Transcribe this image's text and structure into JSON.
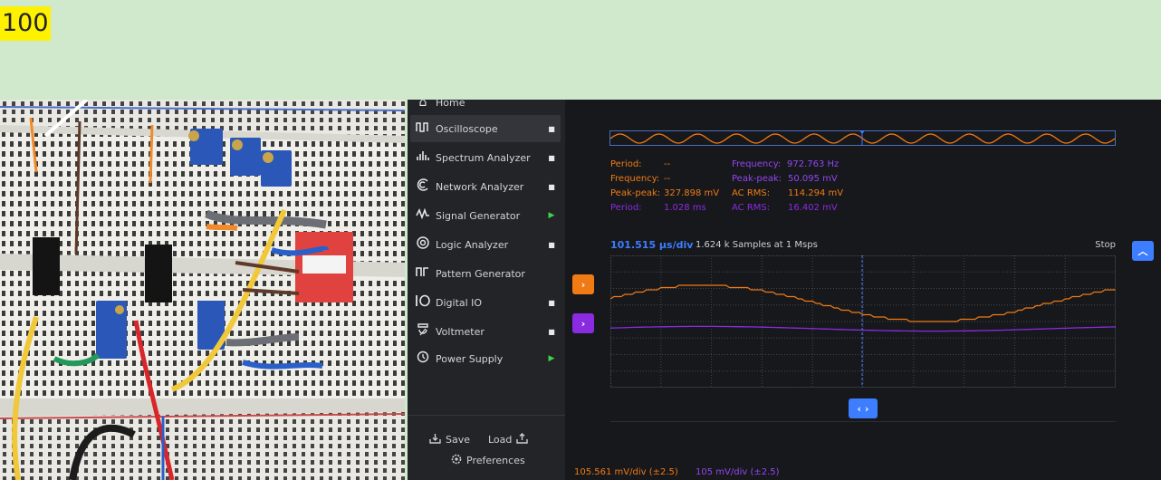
{
  "badge": {
    "text": "100"
  },
  "sidebar": {
    "home_label": "Home",
    "items": [
      {
        "label": "Oscilloscope",
        "icon": "oscilloscope-icon",
        "status": "stop",
        "active": true
      },
      {
        "label": "Spectrum Analyzer",
        "icon": "spectrum-icon",
        "status": "stop",
        "active": false
      },
      {
        "label": "Network Analyzer",
        "icon": "network-icon",
        "status": "stop",
        "active": false
      },
      {
        "label": "Signal Generator",
        "icon": "signal-icon",
        "status": "play",
        "active": false
      },
      {
        "label": "Logic Analyzer",
        "icon": "logic-icon",
        "status": "stop",
        "active": false
      },
      {
        "label": "Pattern Generator",
        "icon": "pattern-icon",
        "status": "none",
        "active": false
      },
      {
        "label": "Digital IO",
        "icon": "digital-io-icon",
        "status": "stop",
        "active": false
      },
      {
        "label": "Voltmeter",
        "icon": "voltmeter-icon",
        "status": "stop",
        "active": false
      },
      {
        "label": "Power Supply",
        "icon": "power-icon",
        "status": "play",
        "active": false
      }
    ],
    "save_label": "Save",
    "load_label": "Load",
    "preferences_label": "Preferences"
  },
  "measurements": {
    "ch1": [
      {
        "label": "Period:",
        "value": "--"
      },
      {
        "label": "Frequency:",
        "value": "--"
      },
      {
        "label": "Peak-peak:",
        "value": "327.898 mV"
      }
    ],
    "ch1_extra": {
      "label": "AC RMS:",
      "value": "114.294 mV"
    },
    "ch2_period": {
      "label": "Period:",
      "value": "1.028 ms"
    },
    "ch2_rms": {
      "label": "AC RMS:",
      "value": "16.402 mV"
    },
    "ch2": [
      {
        "label": "Frequency:",
        "value": "972.763 Hz"
      },
      {
        "label": "Peak-peak:",
        "value": "50.095 mV"
      }
    ]
  },
  "timebase": {
    "label": "101.515 µs/div",
    "samples": "1.624 k Samples at 1 Msps",
    "status": "Stop"
  },
  "scales": {
    "ch1": "105.561 mV/div (±2.5)",
    "ch2": "105 mV/div (±2.5)"
  },
  "colors": {
    "ch1": "#f07a14",
    "ch2": "#8a2be2",
    "accent": "#3d7dff"
  }
}
